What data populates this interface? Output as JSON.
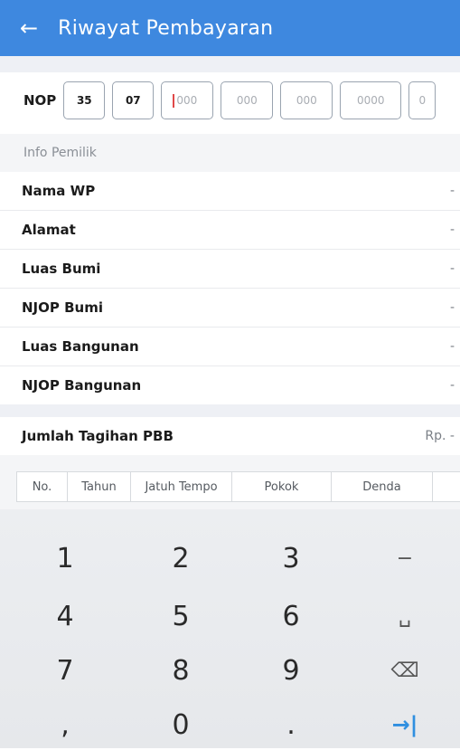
{
  "appbar": {
    "back_icon": "arrow-left-icon",
    "back_glyph": "←",
    "title": "Riwayat Pembayaran",
    "color": "#3e88df"
  },
  "nop": {
    "label": "NOP",
    "fields": [
      {
        "value": "35",
        "placeholder": ""
      },
      {
        "value": "07",
        "placeholder": ""
      },
      {
        "value": "",
        "placeholder": "000"
      },
      {
        "value": "",
        "placeholder": "000"
      },
      {
        "value": "",
        "placeholder": "000"
      },
      {
        "value": "",
        "placeholder": "0000"
      },
      {
        "value": "",
        "placeholder": "0"
      }
    ]
  },
  "info": {
    "header": "Info Pemilik",
    "rows": [
      {
        "label": "Nama WP",
        "value": "-"
      },
      {
        "label": "Alamat",
        "value": "-"
      },
      {
        "label": "Luas Bumi",
        "value": "-"
      },
      {
        "label": "NJOP Bumi",
        "value": "-"
      },
      {
        "label": "Luas Bangunan",
        "value": "-"
      },
      {
        "label": "NJOP Bangunan",
        "value": "-"
      }
    ]
  },
  "total": {
    "label": "Jumlah Tagihan PBB",
    "value": "Rp. -"
  },
  "table": {
    "columns": [
      "No.",
      "Tahun",
      "Jatuh Tempo",
      "Pokok",
      "Denda",
      ""
    ]
  },
  "keyboard": {
    "keys": [
      {
        "label": "1",
        "icon": ""
      },
      {
        "label": "2",
        "icon": ""
      },
      {
        "label": "3",
        "icon": ""
      },
      {
        "label": "−",
        "icon": "minus-icon"
      },
      {
        "label": "4",
        "icon": ""
      },
      {
        "label": "5",
        "icon": ""
      },
      {
        "label": "6",
        "icon": ""
      },
      {
        "label": "␣",
        "icon": "space-icon"
      },
      {
        "label": "7",
        "icon": ""
      },
      {
        "label": "8",
        "icon": ""
      },
      {
        "label": "9",
        "icon": ""
      },
      {
        "label": "⌫",
        "icon": "backspace-icon"
      },
      {
        "label": ",",
        "icon": ""
      },
      {
        "label": "0",
        "icon": ""
      },
      {
        "label": ".",
        "icon": ""
      },
      {
        "label": "→|",
        "icon": "next-icon"
      }
    ],
    "accent": "#2f8fe0"
  }
}
